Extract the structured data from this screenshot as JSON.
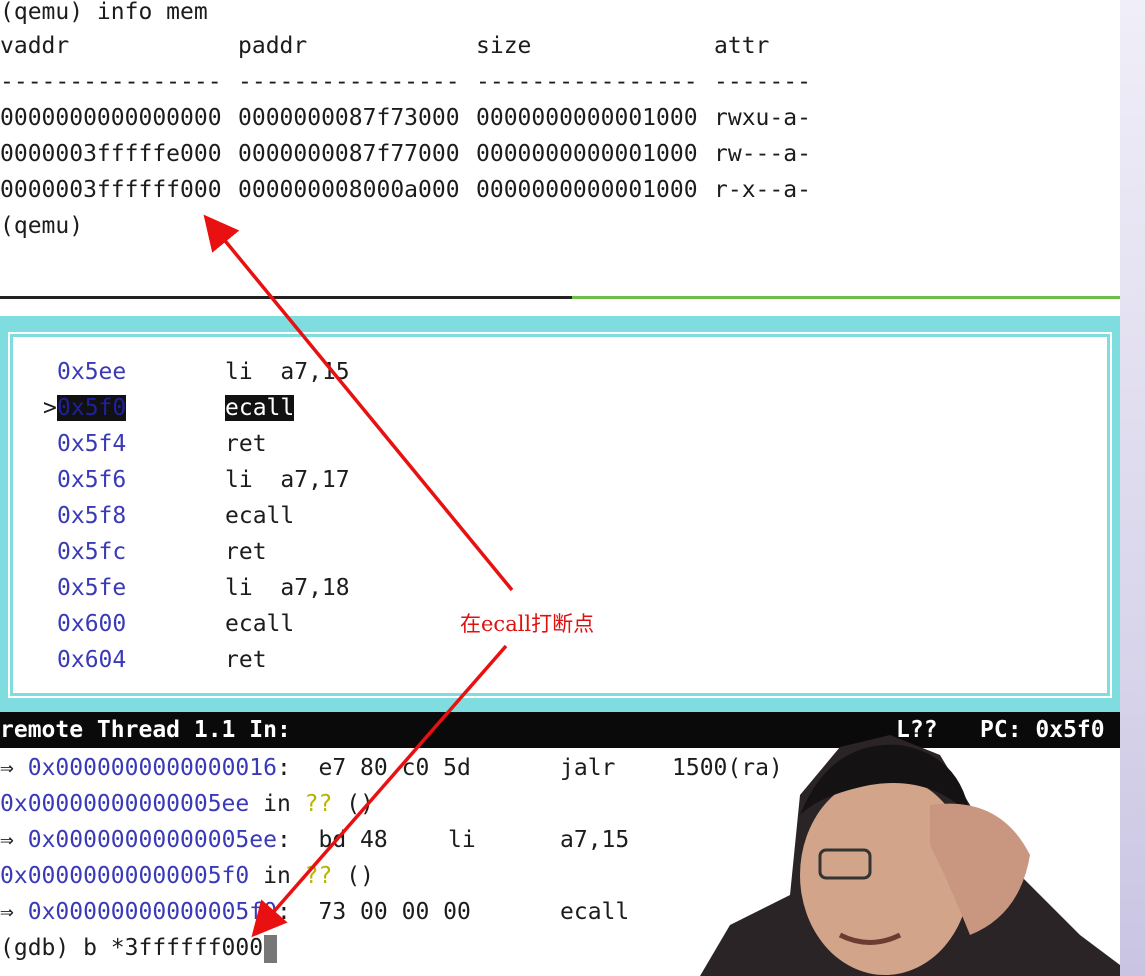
{
  "qemu": {
    "command_line": "(qemu) info mem",
    "headers": [
      "vaddr",
      "paddr",
      "size",
      "attr"
    ],
    "separators": [
      "----------------",
      "----------------",
      "----------------",
      "-------"
    ],
    "rows": [
      {
        "vaddr": "0000000000000000",
        "paddr": "0000000087f73000",
        "size": "0000000000001000",
        "attr": "rwxu-a-"
      },
      {
        "vaddr": "0000003fffffe000",
        "paddr": "0000000087f77000",
        "size": "0000000000001000",
        "attr": "rw---a-"
      },
      {
        "vaddr": "0000003ffffff000",
        "paddr": "000000008000a000",
        "size": "0000000000001000",
        "attr": "r-x--a-"
      }
    ],
    "prompt_line": "(qemu)"
  },
  "asm": {
    "marker": ">",
    "rows": [
      {
        "addr": "0x5ee",
        "ins": "li  a7,15"
      },
      {
        "addr": "0x5f0",
        "ins": "ecall",
        "selected": true
      },
      {
        "addr": "0x5f4",
        "ins": "ret"
      },
      {
        "addr": "0x5f6",
        "ins": "li  a7,17"
      },
      {
        "addr": "0x5f8",
        "ins": "ecall"
      },
      {
        "addr": "0x5fc",
        "ins": "ret"
      },
      {
        "addr": "0x5fe",
        "ins": "li  a7,18"
      },
      {
        "addr": "0x600",
        "ins": "ecall"
      },
      {
        "addr": "0x604",
        "ins": "ret"
      }
    ]
  },
  "status": {
    "left": "remote Thread 1.1 In:",
    "line": "L??",
    "pc": "PC: 0x5f0"
  },
  "gdb": {
    "arrow": "⇒",
    "l1": {
      "addr": "0x0000000000000016",
      "bytes": "e7 80 c0 5d",
      "op": "jalr",
      "args": "1500(ra)"
    },
    "l2": {
      "addr": "0x00000000000005ee",
      "in": "in",
      "qq": "??",
      "paren": "()"
    },
    "l3": {
      "addr": "0x00000000000005ee",
      "bytes": "bd 48",
      "op": "li",
      "args": "a7,15"
    },
    "l4": {
      "addr": "0x00000000000005f0",
      "in": "in",
      "qq": "??",
      "paren": "()"
    },
    "l5": {
      "addr": "0x00000000000005f0",
      "bytes": "73 00 00 00",
      "op": "ecall"
    },
    "prompt": "(gdb) b *3ffffff000"
  },
  "annotation": {
    "text": "在ecall打断点",
    "color": "#e01010"
  },
  "colors": {
    "panel": "#7fdde0",
    "address": "#3a3ab8",
    "divider_green": "#6abf4b"
  }
}
